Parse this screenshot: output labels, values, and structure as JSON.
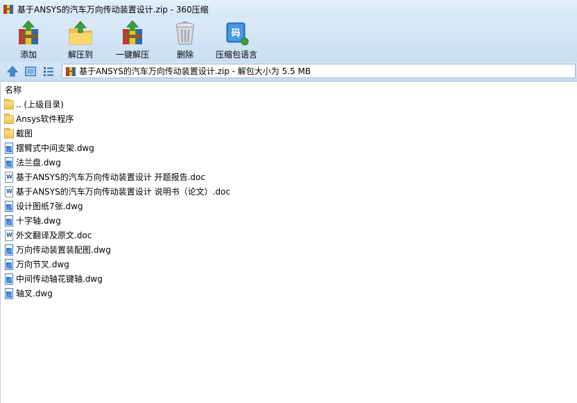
{
  "window": {
    "title": "基于ANSYS的汽车万向传动装置设计.zip - 360压缩",
    "app_icon": "archive-icon"
  },
  "toolbar": {
    "buttons": [
      {
        "label": "添加",
        "icon": "add-icon"
      },
      {
        "label": "解压到",
        "icon": "extract-to-icon"
      },
      {
        "label": "一键解压",
        "icon": "one-click-extract-icon"
      },
      {
        "label": "删除",
        "icon": "delete-icon"
      },
      {
        "label": "压缩包语言",
        "icon": "archive-language-icon"
      }
    ]
  },
  "addressbar": {
    "path": "基于ANSYS的汽车万向传动装置设计.zip - 解包大小为 5.5 MB",
    "nav": [
      "up-icon",
      "view-large-icon",
      "view-list-icon"
    ]
  },
  "filelist": {
    "column_header": "名称",
    "items": [
      {
        "name": ".. (上级目录)",
        "type": "folder"
      },
      {
        "name": "Ansys软件程序",
        "type": "folder"
      },
      {
        "name": "截图",
        "type": "folder"
      },
      {
        "name": "摆臂式中间支架.dwg",
        "type": "dwg"
      },
      {
        "name": "法兰盘.dwg",
        "type": "dwg"
      },
      {
        "name": "基于ANSYS的汽车万向传动装置设计 开题报告.doc",
        "type": "doc"
      },
      {
        "name": "基于ANSYS的汽车万向传动装置设计 说明书（论文）.doc",
        "type": "doc"
      },
      {
        "name": "设计图纸7张.dwg",
        "type": "dwg"
      },
      {
        "name": "十字轴.dwg",
        "type": "dwg"
      },
      {
        "name": "外文翻译及原文.doc",
        "type": "doc"
      },
      {
        "name": "万向传动装置装配图.dwg",
        "type": "dwg"
      },
      {
        "name": "万向节叉.dwg",
        "type": "dwg"
      },
      {
        "name": "中间传动轴花键轴.dwg",
        "type": "dwg"
      },
      {
        "name": "轴叉.dwg",
        "type": "dwg"
      }
    ]
  }
}
